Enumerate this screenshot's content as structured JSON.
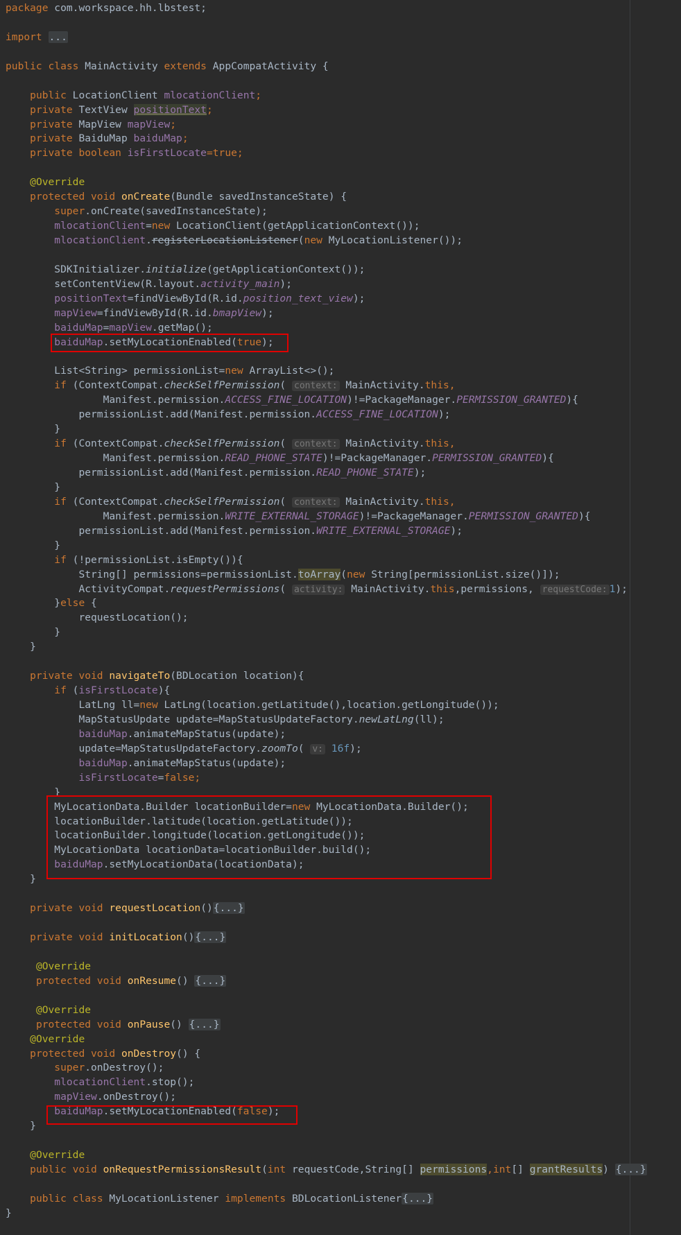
{
  "code": {
    "package_kw": "package",
    "package_name": " com.workspace.hh.lbstest;",
    "import_kw": "import",
    "import_fold": "...",
    "class_decl": {
      "public": "public",
      "class": "class",
      "name": " MainActivity ",
      "extends": "extends",
      "parent": " AppCompatActivity {"
    },
    "fields": [
      {
        "mods": "public",
        "type": " LocationClient ",
        "name": "mlocationClient",
        "end": ";"
      },
      {
        "mods": "private",
        "type": " TextView ",
        "name": "positionText",
        "end": ";"
      },
      {
        "mods": "private",
        "type": " MapView ",
        "name": "mapView",
        "end": ";"
      },
      {
        "mods": "private",
        "type": " BaiduMap ",
        "name": "baiduMap",
        "end": ";"
      },
      {
        "mods": "private boolean",
        "type": " ",
        "name": "isFirstLocate",
        "end": "=true;"
      }
    ],
    "override": "@Override",
    "oncreate_sig": {
      "mods": "protected void",
      "name": "onCreate",
      "rest": "(Bundle savedInstanceState) {"
    },
    "oncreate_body": {
      "l1_super": "super",
      "l1_rest": ".onCreate(savedInstanceState);",
      "l2_field": "mlocationClient",
      "l2_eq": "=",
      "l2_new": "new",
      "l2_rest": " LocationClient(getApplicationContext());",
      "l3_field": "mlocationClient",
      "l3_dot": ".",
      "l3_method": "registerLocationListener",
      "l3_open": "(",
      "l3_new": "new",
      "l3_rest": " MyLocationListener());",
      "l4_a": "SDKInitializer.",
      "l4_m": "initialize",
      "l4_b": "(getApplicationContext());",
      "l5_a": "setContentView(R.layout.",
      "l5_f": "activity_main",
      "l5_b": ");",
      "l6_field": "positionText",
      "l6_a": "=findViewById(R.id.",
      "l6_f": "position_text_view",
      "l6_b": ");",
      "l7_field": "mapView",
      "l7_a": "=findViewById(R.id.",
      "l7_f": "bmapView",
      "l7_b": ");",
      "l8_field": "baiduMap",
      "l8_a": "=",
      "l8_field2": "mapView",
      "l8_b": ".getMap();",
      "l9_field": "baiduMap",
      "l9_a": ".setMyLocationEnabled(",
      "l9_kw": "true",
      "l9_b": ");",
      "l10_a": "List<String> permissionList=",
      "l10_new": "new",
      "l10_b": " ArrayList<>();"
    },
    "perm_blocks": [
      {
        "perm": "ACCESS_FINE_LOCATION"
      },
      {
        "perm": "READ_PHONE_STATE"
      },
      {
        "perm": "WRITE_EXTERNAL_STORAGE"
      }
    ],
    "perm_common": {
      "if": "if",
      "check_a": " (ContextCompat.",
      "check_m": "checkSelfPermission",
      "check_b": "(",
      "hint_context": "context:",
      "main_this_a": " MainActivity.",
      "this": "this",
      "comma": ",",
      "manifest": "Manifest.permission.",
      "ne": ")!=PackageManager.",
      "granted": "PERMISSION_GRANTED",
      "brace": "){",
      "add_a": "permissionList.add(Manifest.permission.",
      "add_b": ");",
      "close": "}"
    },
    "perm_tail": {
      "if": "if",
      "cond": " (!permissionList.isEmpty()){",
      "arr_a": "String[] permissions=permissionList.",
      "arr_m": "toArray",
      "arr_b": "(",
      "arr_new": "new",
      "arr_c": " String[permissionList.size()]);",
      "req_a": "ActivityCompat.",
      "req_m": "requestPermissions",
      "req_b": "(",
      "hint_activity": "activity:",
      "req_c": " MainActivity.",
      "req_this": "this",
      "req_d": ",permissions,",
      "hint_reqcode": "requestCode:",
      "req_num": "1",
      "req_e": ");",
      "else_a": "}",
      "else": "else",
      "else_b": " {",
      "call": "requestLocation();",
      "close": "}"
    },
    "navigate_sig": {
      "mods": "private void",
      "name": "navigateTo",
      "rest": "(BDLocation location){"
    },
    "navigate_body": {
      "if": "if",
      "cond_a": " (",
      "cond_f": "isFirstLocate",
      "cond_b": "){",
      "ll_a": "LatLng ll=",
      "ll_new": "new",
      "ll_b": " LatLng(location.getLatitude(),location.getLongitude());",
      "upd_a": "MapStatusUpdate update=MapStatusUpdateFactory.",
      "upd_m": "newLatLng",
      "upd_b": "(ll);",
      "anim_f": "baiduMap",
      "anim_a": ".animateMapStatus(update);",
      "zoom_a": "update=MapStatusUpdateFactory.",
      "zoom_m": "zoomTo",
      "zoom_b": "(",
      "hint_v": "v:",
      "zoom_num": "16f",
      "zoom_c": ");",
      "anim2_f": "baiduMap",
      "anim2_a": ".animateMapStatus(update);",
      "first_f": "isFirstLocate",
      "first_eq": "=",
      "first_kw": "false",
      "first_end": ";",
      "close_if": "}",
      "b1_a": "MyLocationData.Builder locationBuilder=",
      "b1_new": "new",
      "b1_b": " MyLocationData.Builder();",
      "b2": "locationBuilder.latitude(location.getLatitude());",
      "b3": "locationBuilder.longitude(location.getLongitude());",
      "b4": "MyLocationData locationData=locationBuilder.build();",
      "b5_f": "baiduMap",
      "b5_a": ".setMyLocationData(locationData);",
      "close": "}"
    },
    "req_loc": {
      "mods": "private void",
      "name": "requestLocation",
      "rest": "()",
      "fold": "{...}"
    },
    "init_loc": {
      "mods": "private void",
      "name": "initLocation",
      "rest": "()",
      "fold": "{...}"
    },
    "on_resume": {
      "mods": "protected void",
      "name": "onResume",
      "rest": "() ",
      "fold": "{...}"
    },
    "on_pause": {
      "mods": "protected void",
      "name": "onPause",
      "rest": "() ",
      "fold": "{...}"
    },
    "on_destroy": {
      "mods": "protected void",
      "name": "onDestroy",
      "rest": "() {",
      "d1_super": "super",
      "d1_rest": ".onDestroy();",
      "d2_f": "mlocationClient",
      "d2_rest": ".stop();",
      "d3_f": "mapView",
      "d3_rest": ".onDestroy();",
      "d4_f": "baiduMap",
      "d4_a": ".setMyLocationEnabled(",
      "d4_kw": "false",
      "d4_b": ");",
      "close": "}"
    },
    "on_perm_result": {
      "mods": "public void",
      "name": "onRequestPermissionsResult",
      "open": "(",
      "int1": "int",
      "mid": " requestCode,String[] ",
      "p1": "permissions",
      "comma": ",",
      "int2": "int",
      "arr": "[] ",
      "p2": "grantResults",
      "close": ") ",
      "fold": "{...}"
    },
    "listener": {
      "public": "public",
      "class": "class",
      "name": " MyLocationListener ",
      "impl": "implements",
      "rest": " BDLocationListener",
      "fold": "{...}"
    },
    "class_close": "}"
  }
}
